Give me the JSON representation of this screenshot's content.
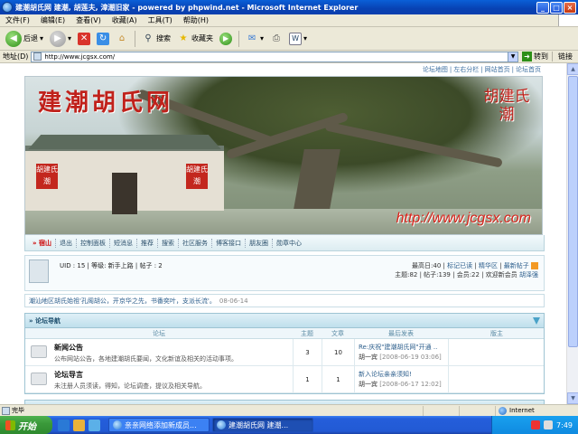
{
  "window": {
    "title": "建潮胡氏网 建潮, 胡莲夫, 漳潮旧家 - powered by phpwind.net - Microsoft Internet Explorer",
    "buttons": [
      "_",
      "□",
      "×"
    ]
  },
  "menu": [
    "文件(F)",
    "编辑(E)",
    "查看(V)",
    "收藏(A)",
    "工具(T)",
    "帮助(H)"
  ],
  "toolbar": {
    "back": "后退",
    "search": "搜索",
    "favorites": "收藏夹"
  },
  "address": {
    "label": "地址(D)",
    "url": "http://www.jcgsx.com/",
    "go": "转到",
    "links": "链接"
  },
  "page": {
    "top_links": [
      "论坛地图",
      "左右分栏",
      "网站首页",
      "论坛首页"
    ],
    "banner": {
      "title": "建潮胡氏网",
      "seal": "胡建氏潮",
      "plaque_left": "胡建氏潮",
      "plaque_right": "胡建氏潮",
      "url": "http://www.jcgsx.com"
    },
    "nav": [
      "宿山",
      "退出",
      "控制面板",
      "短消息",
      "推荐",
      "搜索",
      "社区服务",
      "博客接口",
      "朋友圈",
      "勋章中心"
    ],
    "user": {
      "info": "UID : 15 | 等级: 新手上路 | 帖子 : 2",
      "stats_line1_prefix": "最高日:40 |",
      "stats_links": [
        "标记已读",
        "精华区",
        "最新帖子"
      ],
      "stats_line2_prefix": "主题:82 | 帖子:139 | 会员:22 | 欢迎新会员 ",
      "new_member": "胡泽强"
    },
    "notice": {
      "text": "潮汕地区胡氏始祖'孔阁胡公，开京华之先，书番奕叶，支派长流'。",
      "date": "08-06-14"
    },
    "section": {
      "title": "» 论坛导航",
      "columns": [
        "论坛",
        "主题",
        "文章",
        "最后发表",
        "版主"
      ],
      "rows": [
        {
          "name": "新闻公告",
          "desc": "公布网站公告，各地建潮胡氏要闻，文化新谊及相关的活动事项。",
          "topics": "3",
          "posts": "10",
          "last_title": "Re:庆祝\"建潮胡氏网\"开通 ..",
          "last_user": "胡一宾",
          "last_date": "[2008-06-19 03:06]"
        },
        {
          "name": "论坛导言",
          "desc": "未注册人员须读，得知，论坛调查，提议及相关导航。",
          "topics": "1",
          "posts": "1",
          "last_title": "新入论坛亲亲须知!",
          "last_user": "胡一宾",
          "last_date": "[2008-06-17 12:02]"
        }
      ]
    }
  },
  "status": {
    "text": "完毕",
    "zone": "Internet"
  },
  "taskbar": {
    "start": "开始",
    "tasks": [
      "亲亲网络添加新成员...",
      "建潮胡氏网 建潮..."
    ],
    "clock": "7:49"
  }
}
